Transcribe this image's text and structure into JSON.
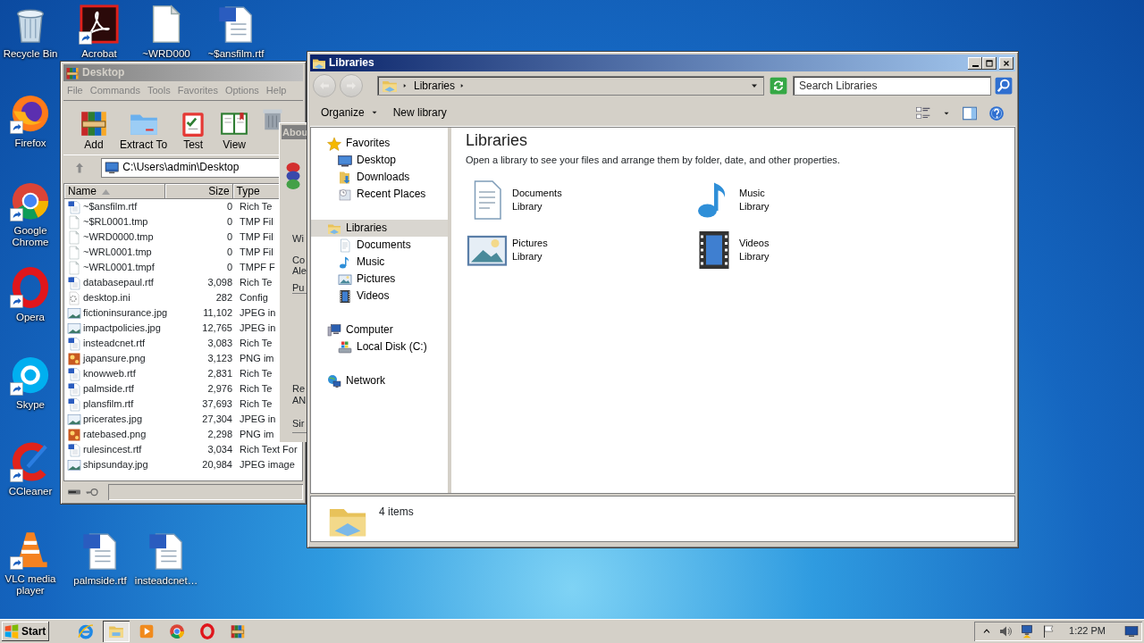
{
  "desktop_icons": [
    {
      "label": "Recycle Bin",
      "kind": "recycle",
      "shortcut": false
    },
    {
      "label": "Acrobat",
      "kind": "pdf",
      "shortcut": true
    },
    {
      "label": "~WRD000",
      "kind": "file",
      "shortcut": false
    },
    {
      "label": "~$ansfilm.rtf",
      "kind": "word",
      "shortcut": false
    },
    {
      "label": "Firefox",
      "kind": "firefox",
      "shortcut": true
    },
    {
      "label": "Google Chrome",
      "kind": "chrome",
      "shortcut": true
    },
    {
      "label": "Opera",
      "kind": "opera",
      "shortcut": true
    },
    {
      "label": "Skype",
      "kind": "skype",
      "shortcut": true
    },
    {
      "label": "CCleaner",
      "kind": "ccleaner",
      "shortcut": true
    },
    {
      "label": "VLC media player",
      "kind": "vlc",
      "shortcut": true
    },
    {
      "label": "palmside.rtf",
      "kind": "word",
      "shortcut": false
    },
    {
      "label": "insteadcnet…",
      "kind": "word",
      "shortcut": false
    }
  ],
  "archiver": {
    "active": false,
    "title": "Desktop",
    "menu": [
      "File",
      "Commands",
      "Tools",
      "Favorites",
      "Options",
      "Help"
    ],
    "toolbar": [
      {
        "label": "Add",
        "kind": "add"
      },
      {
        "label": "Extract To",
        "kind": "extract"
      },
      {
        "label": "Test",
        "kind": "test"
      },
      {
        "label": "View",
        "kind": "view"
      },
      {
        "kind": "delete"
      }
    ],
    "path": "C:\\Users\\admin\\Desktop",
    "columns": [
      {
        "label": "Name",
        "sorted": true
      },
      {
        "label": "Size",
        "sorted": false
      },
      {
        "label": "Type",
        "sorted": false
      }
    ],
    "files": [
      {
        "name": "~$ansfilm.rtf",
        "size": "0",
        "type": "Rich Te",
        "kind": "word"
      },
      {
        "name": "~$RL0001.tmp",
        "size": "0",
        "type": "TMP Fil",
        "kind": "file"
      },
      {
        "name": "~WRD0000.tmp",
        "size": "0",
        "type": "TMP Fil",
        "kind": "file"
      },
      {
        "name": "~WRL0001.tmp",
        "size": "0",
        "type": "TMP Fil",
        "kind": "file"
      },
      {
        "name": "~WRL0001.tmpf",
        "size": "0",
        "type": "TMPF F",
        "kind": "file"
      },
      {
        "name": "databasepaul.rtf",
        "size": "3,098",
        "type": "Rich Te",
        "kind": "word"
      },
      {
        "name": "desktop.ini",
        "size": "282",
        "type": "Config",
        "kind": "ini"
      },
      {
        "name": "fictioninsurance.jpg",
        "size": "11,102",
        "type": "JPEG in",
        "kind": "jpg"
      },
      {
        "name": "impactpolicies.jpg",
        "size": "12,765",
        "type": "JPEG in",
        "kind": "jpg"
      },
      {
        "name": "insteadcnet.rtf",
        "size": "3,083",
        "type": "Rich Te",
        "kind": "word"
      },
      {
        "name": "japansure.png",
        "size": "3,123",
        "type": "PNG im",
        "kind": "png"
      },
      {
        "name": "knowweb.rtf",
        "size": "2,831",
        "type": "Rich Te",
        "kind": "word"
      },
      {
        "name": "palmside.rtf",
        "size": "2,976",
        "type": "Rich Te",
        "kind": "word"
      },
      {
        "name": "plansfilm.rtf",
        "size": "37,693",
        "type": "Rich Te",
        "kind": "word"
      },
      {
        "name": "pricerates.jpg",
        "size": "27,304",
        "type": "JPEG in",
        "kind": "jpg"
      },
      {
        "name": "ratebased.png",
        "size": "2,298",
        "type": "PNG im",
        "kind": "png"
      },
      {
        "name": "rulesincest.rtf",
        "size": "3,034",
        "type": "Rich Text For",
        "kind": "word"
      },
      {
        "name": "shipsunday.jpg",
        "size": "20,984",
        "type": "JPEG image",
        "kind": "jpg"
      }
    ]
  },
  "about_dialog": {
    "title": "Abou",
    "lines": [
      "Wi",
      "Co",
      "Ale",
      "Pu",
      "Re",
      "AN",
      "Sir"
    ]
  },
  "explorer": {
    "active": true,
    "title": "Libraries",
    "nav_buttons": [
      {
        "kind": "back",
        "disabled": true
      },
      {
        "kind": "forward",
        "disabled": true
      }
    ],
    "breadcrumb": [
      "Libraries"
    ],
    "search": {
      "placeholder": "Search Libraries"
    },
    "commands": [
      {
        "label": "Organize",
        "dropdown": true
      },
      {
        "label": "New library",
        "dropdown": false
      }
    ],
    "nav": [
      {
        "label": "Favorites",
        "kind": "star",
        "selected": false,
        "children": [
          {
            "label": "Desktop",
            "kind": "desktop",
            "selected": false
          },
          {
            "label": "Downloads",
            "kind": "downloads",
            "selected": false
          },
          {
            "label": "Recent Places",
            "kind": "recent",
            "selected": false
          }
        ]
      },
      {
        "label": "Libraries",
        "kind": "libraries",
        "selected": true,
        "children": [
          {
            "label": "Documents",
            "kind": "documents",
            "selected": false
          },
          {
            "label": "Music",
            "kind": "music",
            "selected": false
          },
          {
            "label": "Pictures",
            "kind": "pictures",
            "selected": false
          },
          {
            "label": "Videos",
            "kind": "videos",
            "selected": false
          }
        ]
      },
      {
        "label": "Computer",
        "kind": "computer",
        "selected": false,
        "children": [
          {
            "label": "Local Disk (C:)",
            "kind": "disk",
            "selected": false
          }
        ]
      },
      {
        "label": "Network",
        "kind": "network",
        "selected": false
      }
    ],
    "heading": "Libraries",
    "description": "Open a library to see your files and arrange them by folder, date, and other properties.",
    "libraries": [
      {
        "name": "Documents",
        "subtitle": "Library",
        "kind": "documents"
      },
      {
        "name": "Music",
        "subtitle": "Library",
        "kind": "music"
      },
      {
        "name": "Pictures",
        "subtitle": "Library",
        "kind": "pictures"
      },
      {
        "name": "Videos",
        "subtitle": "Library",
        "kind": "videos"
      }
    ],
    "status": "4 items"
  },
  "taskbar": {
    "start": "Start",
    "buttons": [
      {
        "kind": "ie",
        "selected": false
      },
      {
        "kind": "explorer",
        "selected": true
      },
      {
        "kind": "media",
        "selected": false
      },
      {
        "kind": "chrome",
        "selected": false
      },
      {
        "kind": "opera",
        "selected": false
      },
      {
        "kind": "winrar",
        "selected": false
      }
    ],
    "clock": "1:22 PM"
  }
}
